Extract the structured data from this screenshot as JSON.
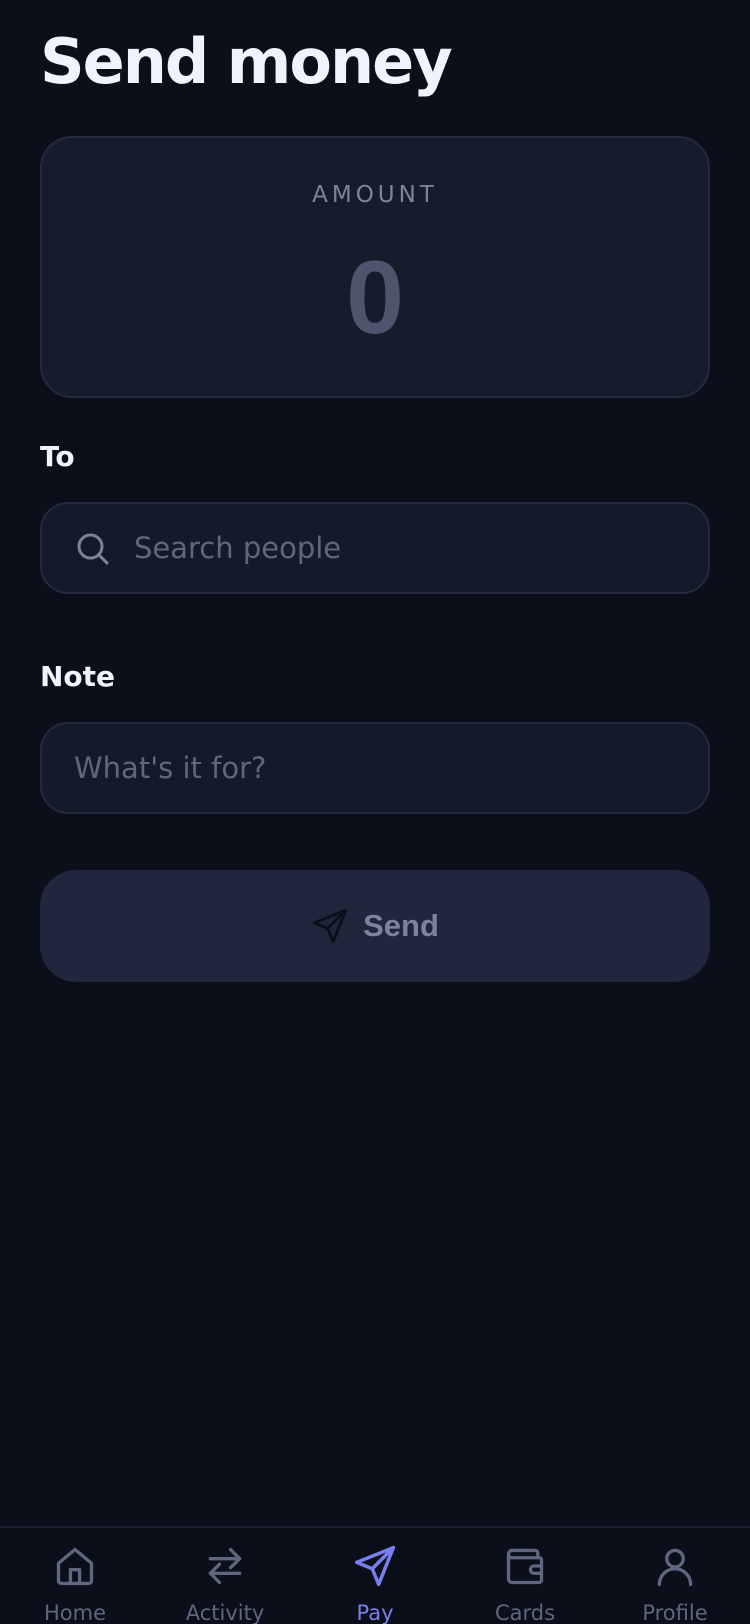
{
  "header": {
    "title": "Send money"
  },
  "amount": {
    "label": "AMOUNT",
    "value": "0"
  },
  "recipient": {
    "label": "To",
    "placeholder": "Search people",
    "value": ""
  },
  "note": {
    "label": "Note",
    "placeholder": "What's it for?",
    "value": ""
  },
  "send_button": {
    "label": "Send",
    "icon": "paper-plane-icon"
  },
  "tab_bar": {
    "items": [
      {
        "label": "Home",
        "icon": "home-icon",
        "active": false
      },
      {
        "label": "Activity",
        "icon": "arrows-exchange-icon",
        "active": false
      },
      {
        "label": "Pay",
        "icon": "paper-plane-icon",
        "active": true
      },
      {
        "label": "Cards",
        "icon": "wallet-icon",
        "active": false
      },
      {
        "label": "Profile",
        "icon": "user-icon",
        "active": false
      }
    ]
  },
  "colors": {
    "background": "#0b0f1a",
    "card": "#171c2d",
    "accent": "#7a7ff0",
    "muted_text": "#7c849c"
  }
}
